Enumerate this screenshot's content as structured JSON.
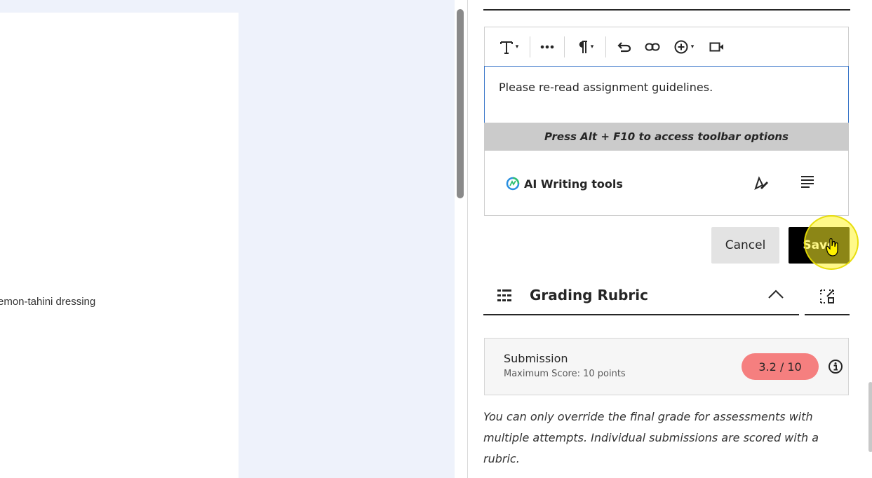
{
  "document": {
    "visible_text": "emon-tahini dressing"
  },
  "editor": {
    "toolbar": {
      "items": [
        {
          "name": "text-format",
          "icon": "text-format-icon"
        },
        {
          "name": "more",
          "icon": "more-icon"
        },
        {
          "name": "paragraph",
          "icon": "paragraph-icon"
        },
        {
          "name": "undo",
          "icon": "undo-icon"
        },
        {
          "name": "link",
          "icon": "link-icon"
        },
        {
          "name": "insert",
          "icon": "plus-circle-icon"
        },
        {
          "name": "video",
          "icon": "video-icon"
        }
      ]
    },
    "content": "Please re-read assignment guidelines.",
    "hint": "Press Alt + F10 to access toolbar options",
    "ai_tools_label": "AI Writing tools"
  },
  "actions": {
    "cancel_label": "Cancel",
    "save_label": "Save"
  },
  "rubric": {
    "title": "Grading Rubric",
    "submission": {
      "title": "Submission",
      "max_score": "Maximum Score: 10 points",
      "score": "3.2 / 10",
      "score_color": "#f57f7f"
    },
    "note": "You can only override the final grade for assessments with multiple attempts. Individual submissions are scored with a rubric."
  },
  "colors": {
    "accent_blue": "#3b77c9",
    "save_bg": "#000000",
    "cursor_highlight": "#fff428"
  }
}
